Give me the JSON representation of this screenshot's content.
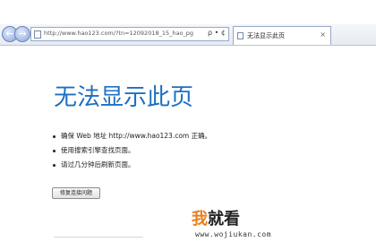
{
  "browser": {
    "address_url": "http://www.hao123.com/?tn=12092018_15_hao_pg",
    "address_tools": "ρ • ¢",
    "tab_title": "无法显示此页",
    "tab_close": "×",
    "back_glyph": "←",
    "forward_glyph": "→"
  },
  "page": {
    "title": "无法显示此页",
    "bullets": [
      "确保 Web 地址 http://www.hao123.com 正确。",
      "使用搜索引擎查找页面。",
      "请过几分钟后刷新页面。"
    ],
    "fix_button_label": "修复连接问题"
  },
  "watermark": {
    "logo_first": "我",
    "logo_rest": "就看",
    "url": "www.wojiukan.com"
  },
  "colors": {
    "title": "#1d6fc4",
    "watermark_accent": "#e8801f"
  },
  "icons": [
    "back-icon",
    "forward-icon",
    "page-icon",
    "search-icon",
    "refresh-icon",
    "tab-page-icon",
    "close-icon"
  ]
}
